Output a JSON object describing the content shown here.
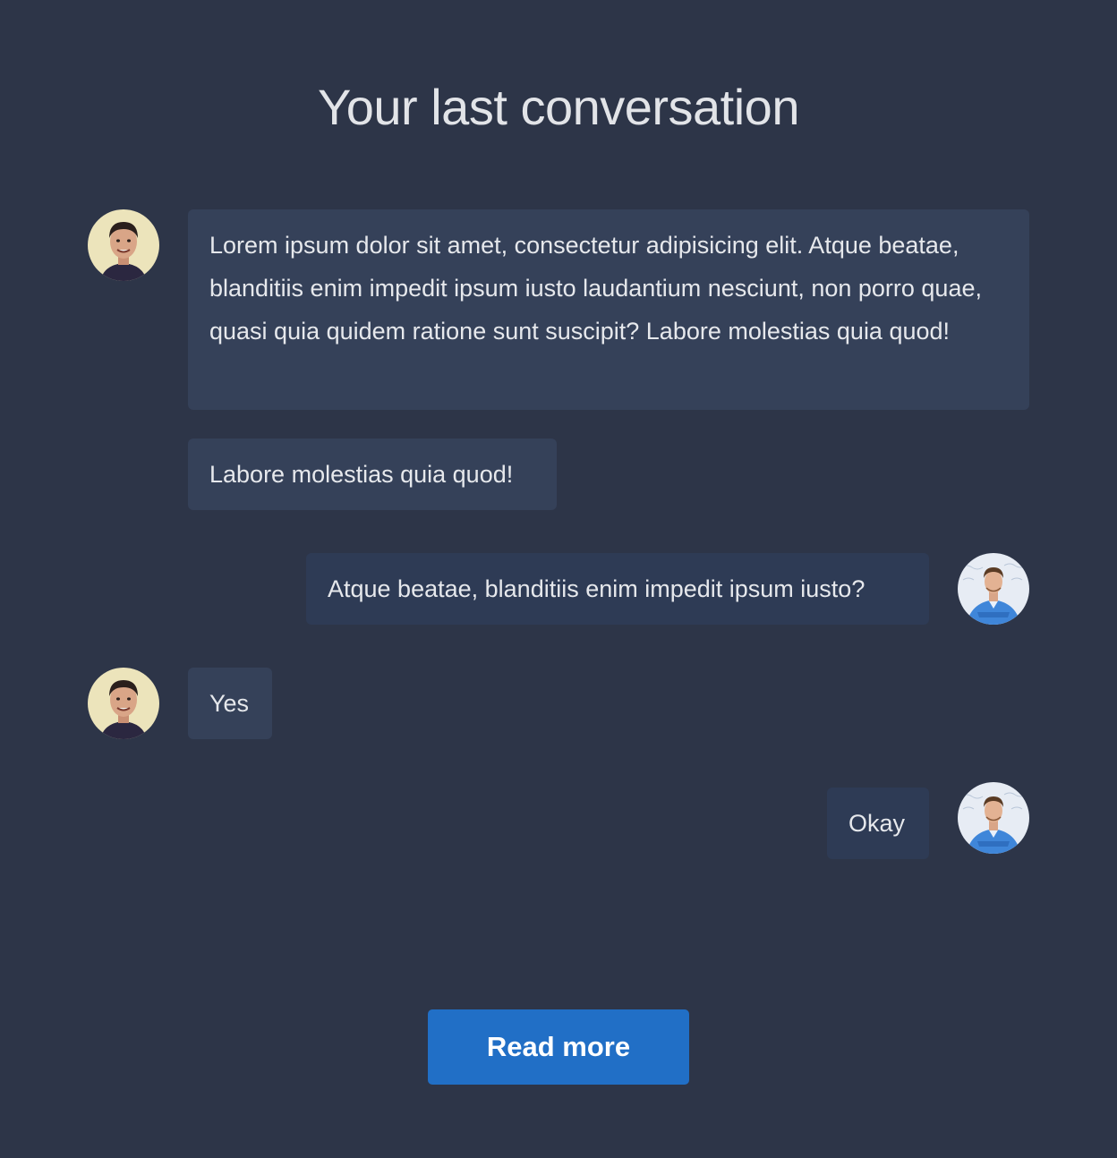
{
  "page": {
    "title": "Your last conversation"
  },
  "conversation": {
    "messages": [
      {
        "sender": "contact",
        "text": "Lorem ipsum dolor sit amet, consectetur adipisicing elit. Atque beatae, blanditiis enim impedit ipsum iusto laudantium nesciunt, non porro quae, quasi quia quidem ratione sunt suscipit? Labore molestias quia quod!"
      },
      {
        "sender": "contact",
        "text": "Labore molestias quia quod!"
      },
      {
        "sender": "user",
        "text": "Atque beatae, blanditiis enim impedit ipsum iusto?"
      },
      {
        "sender": "contact",
        "text": "Yes"
      },
      {
        "sender": "user",
        "text": "Okay"
      }
    ]
  },
  "actions": {
    "read_more_label": "Read more"
  },
  "colors": {
    "background": "#2d3548",
    "incoming_bubble": "#354159",
    "outgoing_bubble": "#2e3b55",
    "button": "#216fc6",
    "text": "#e6e8ec"
  },
  "icons": {
    "contact_avatar": "contact-avatar-icon",
    "user_avatar": "user-avatar-icon"
  }
}
